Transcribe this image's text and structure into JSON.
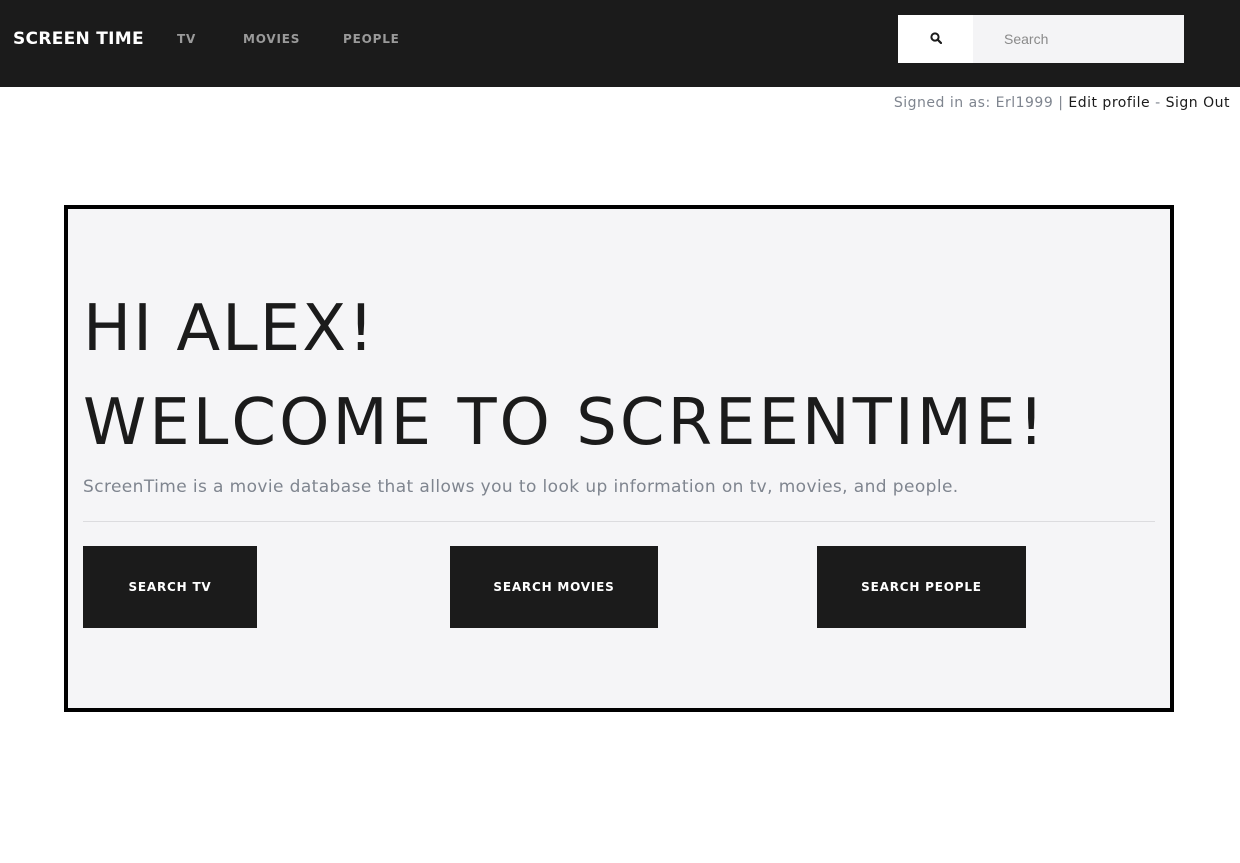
{
  "nav": {
    "brand": "SCREEN TIME",
    "links": [
      {
        "label": "TV"
      },
      {
        "label": "MOVIES"
      },
      {
        "label": "PEOPLE"
      }
    ],
    "search": {
      "icon": "search-icon",
      "placeholder": "Search",
      "value": ""
    }
  },
  "user": {
    "signed_in_prefix": "Signed in as: ",
    "username": "Erl1999",
    "separator": " | ",
    "edit_profile": "Edit profile",
    "dash": " - ",
    "sign_out": "Sign Out"
  },
  "hero": {
    "greeting": "HI ALEX!",
    "welcome": "WELCOME TO SCREENTIME!",
    "description": "ScreenTime is a movie database that allows you to look up information on tv, movies, and people.",
    "buttons": [
      {
        "label": "SEARCH TV"
      },
      {
        "label": "SEARCH MOVIES"
      },
      {
        "label": "SEARCH PEOPLE"
      }
    ]
  },
  "colors": {
    "navbar": "#1b1b1b",
    "jumbotron": "#f5f5f7",
    "muted_text": "#7f858f"
  }
}
